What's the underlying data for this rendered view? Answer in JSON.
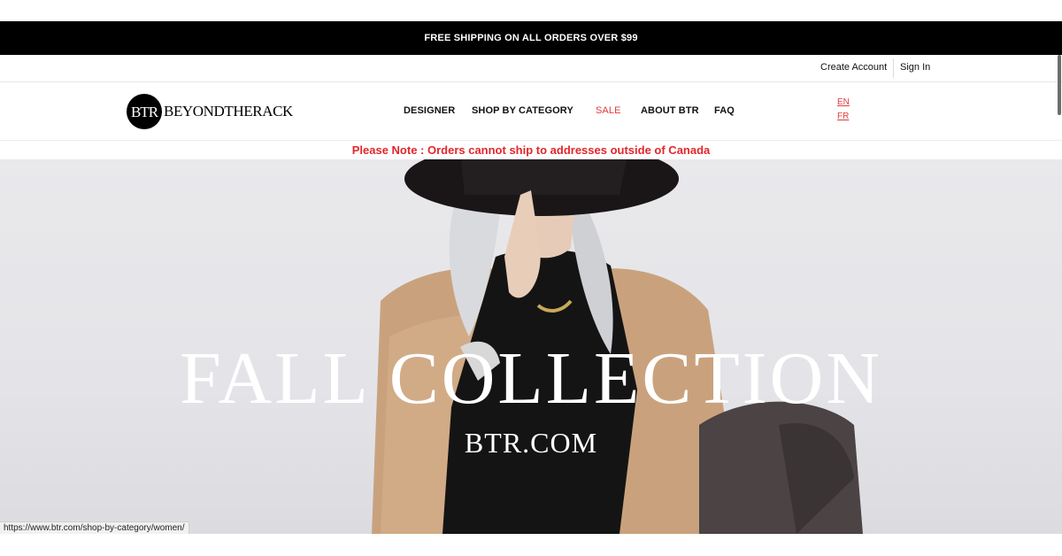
{
  "promo": {
    "text": "FREE SHIPPING ON ALL ORDERS OVER $99"
  },
  "account": {
    "create_account": "Create Account",
    "sign_in": "Sign In"
  },
  "logo": {
    "monogram": "BTR",
    "wordmark": "BEYONDTHERACK"
  },
  "nav": {
    "designer": "DESIGNER",
    "shop_by_category": "SHOP BY CATEGORY",
    "sale": "SALE",
    "about": "ABOUT BTR",
    "faq": "FAQ"
  },
  "languages": {
    "en": "EN",
    "fr": "FR"
  },
  "notice": {
    "text": "Please Note : Orders cannot ship to addresses outside of Canada"
  },
  "hero": {
    "title": "FALL COLLECTION",
    "subtitle": "BTR.COM"
  },
  "status_bar": {
    "url": "https://www.btr.com/shop-by-category/women/"
  },
  "colors": {
    "accent_red": "#e3262b",
    "promo_bg": "#000000",
    "hero_bg": "#e6e6ea"
  },
  "icons": {
    "logo": "btr-logo-icon"
  }
}
